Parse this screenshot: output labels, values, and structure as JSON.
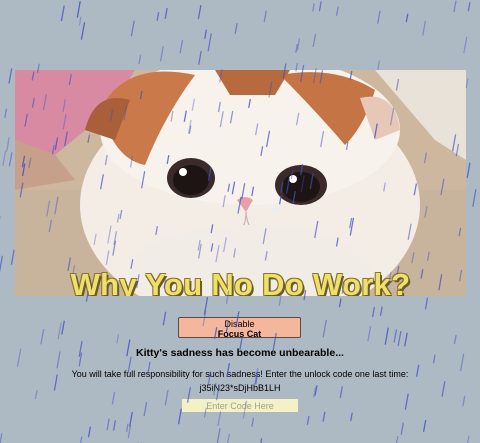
{
  "hero": {
    "headline": "Why You No Do Work?"
  },
  "controls": {
    "disable_label": "Disable",
    "disable_target": "Focus Cat",
    "sadness_message": "Kitty's sadness has become unbearable...",
    "responsibility_message": "You will take full responsibility for such sadness! Enter the unlock code one last time:",
    "unlock_code": "j35iN23*sDjHbB1LH",
    "code_placeholder": "Enter Code Here"
  },
  "colors": {
    "background": "#aebac3",
    "headline": "#efe06a",
    "button": "#f4b79d",
    "input": "#f4f1c6",
    "rain": "#3f4fc0"
  }
}
